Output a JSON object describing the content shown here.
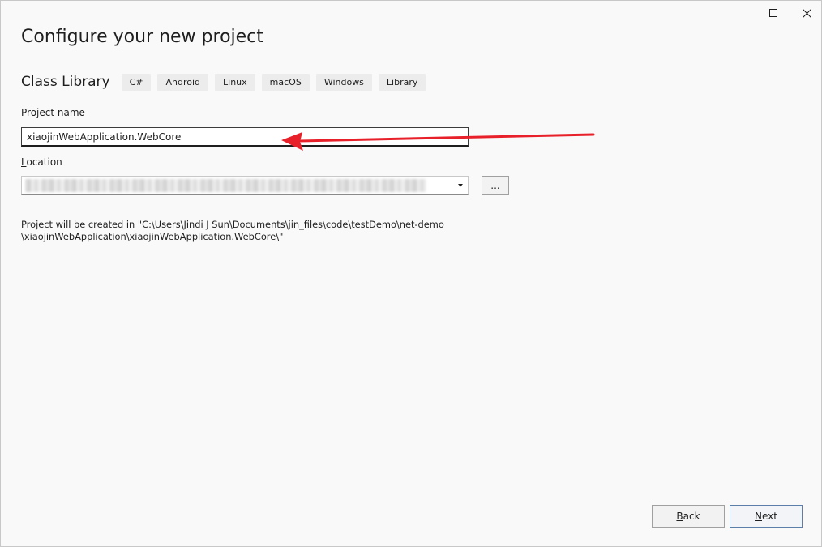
{
  "window": {
    "title": "Configure your new project",
    "controls": {
      "maximize": "square-icon",
      "close": "close-icon"
    }
  },
  "template": {
    "name": "Class Library",
    "tags": [
      "C#",
      "Android",
      "Linux",
      "macOS",
      "Windows",
      "Library"
    ]
  },
  "project_name": {
    "label": "Project name",
    "value": "xiaojinWebApplication.WebCore"
  },
  "location": {
    "label_first": "L",
    "label_rest": "ocation",
    "value": "",
    "browse_label": "..."
  },
  "info": {
    "line1": "Project will be created in \"C:\\Users\\Jindi J Sun\\Documents\\jin_files\\code\\testDemo\\net-demo",
    "line2": "\\xiaojinWebApplication\\xiaojinWebApplication.WebCore\\\""
  },
  "footer": {
    "back_first": "B",
    "back_rest": "ack",
    "next_first": "N",
    "next_rest": "ext"
  },
  "colors": {
    "annotation_arrow": "#e8202a",
    "next_border": "#5b7fa8"
  }
}
